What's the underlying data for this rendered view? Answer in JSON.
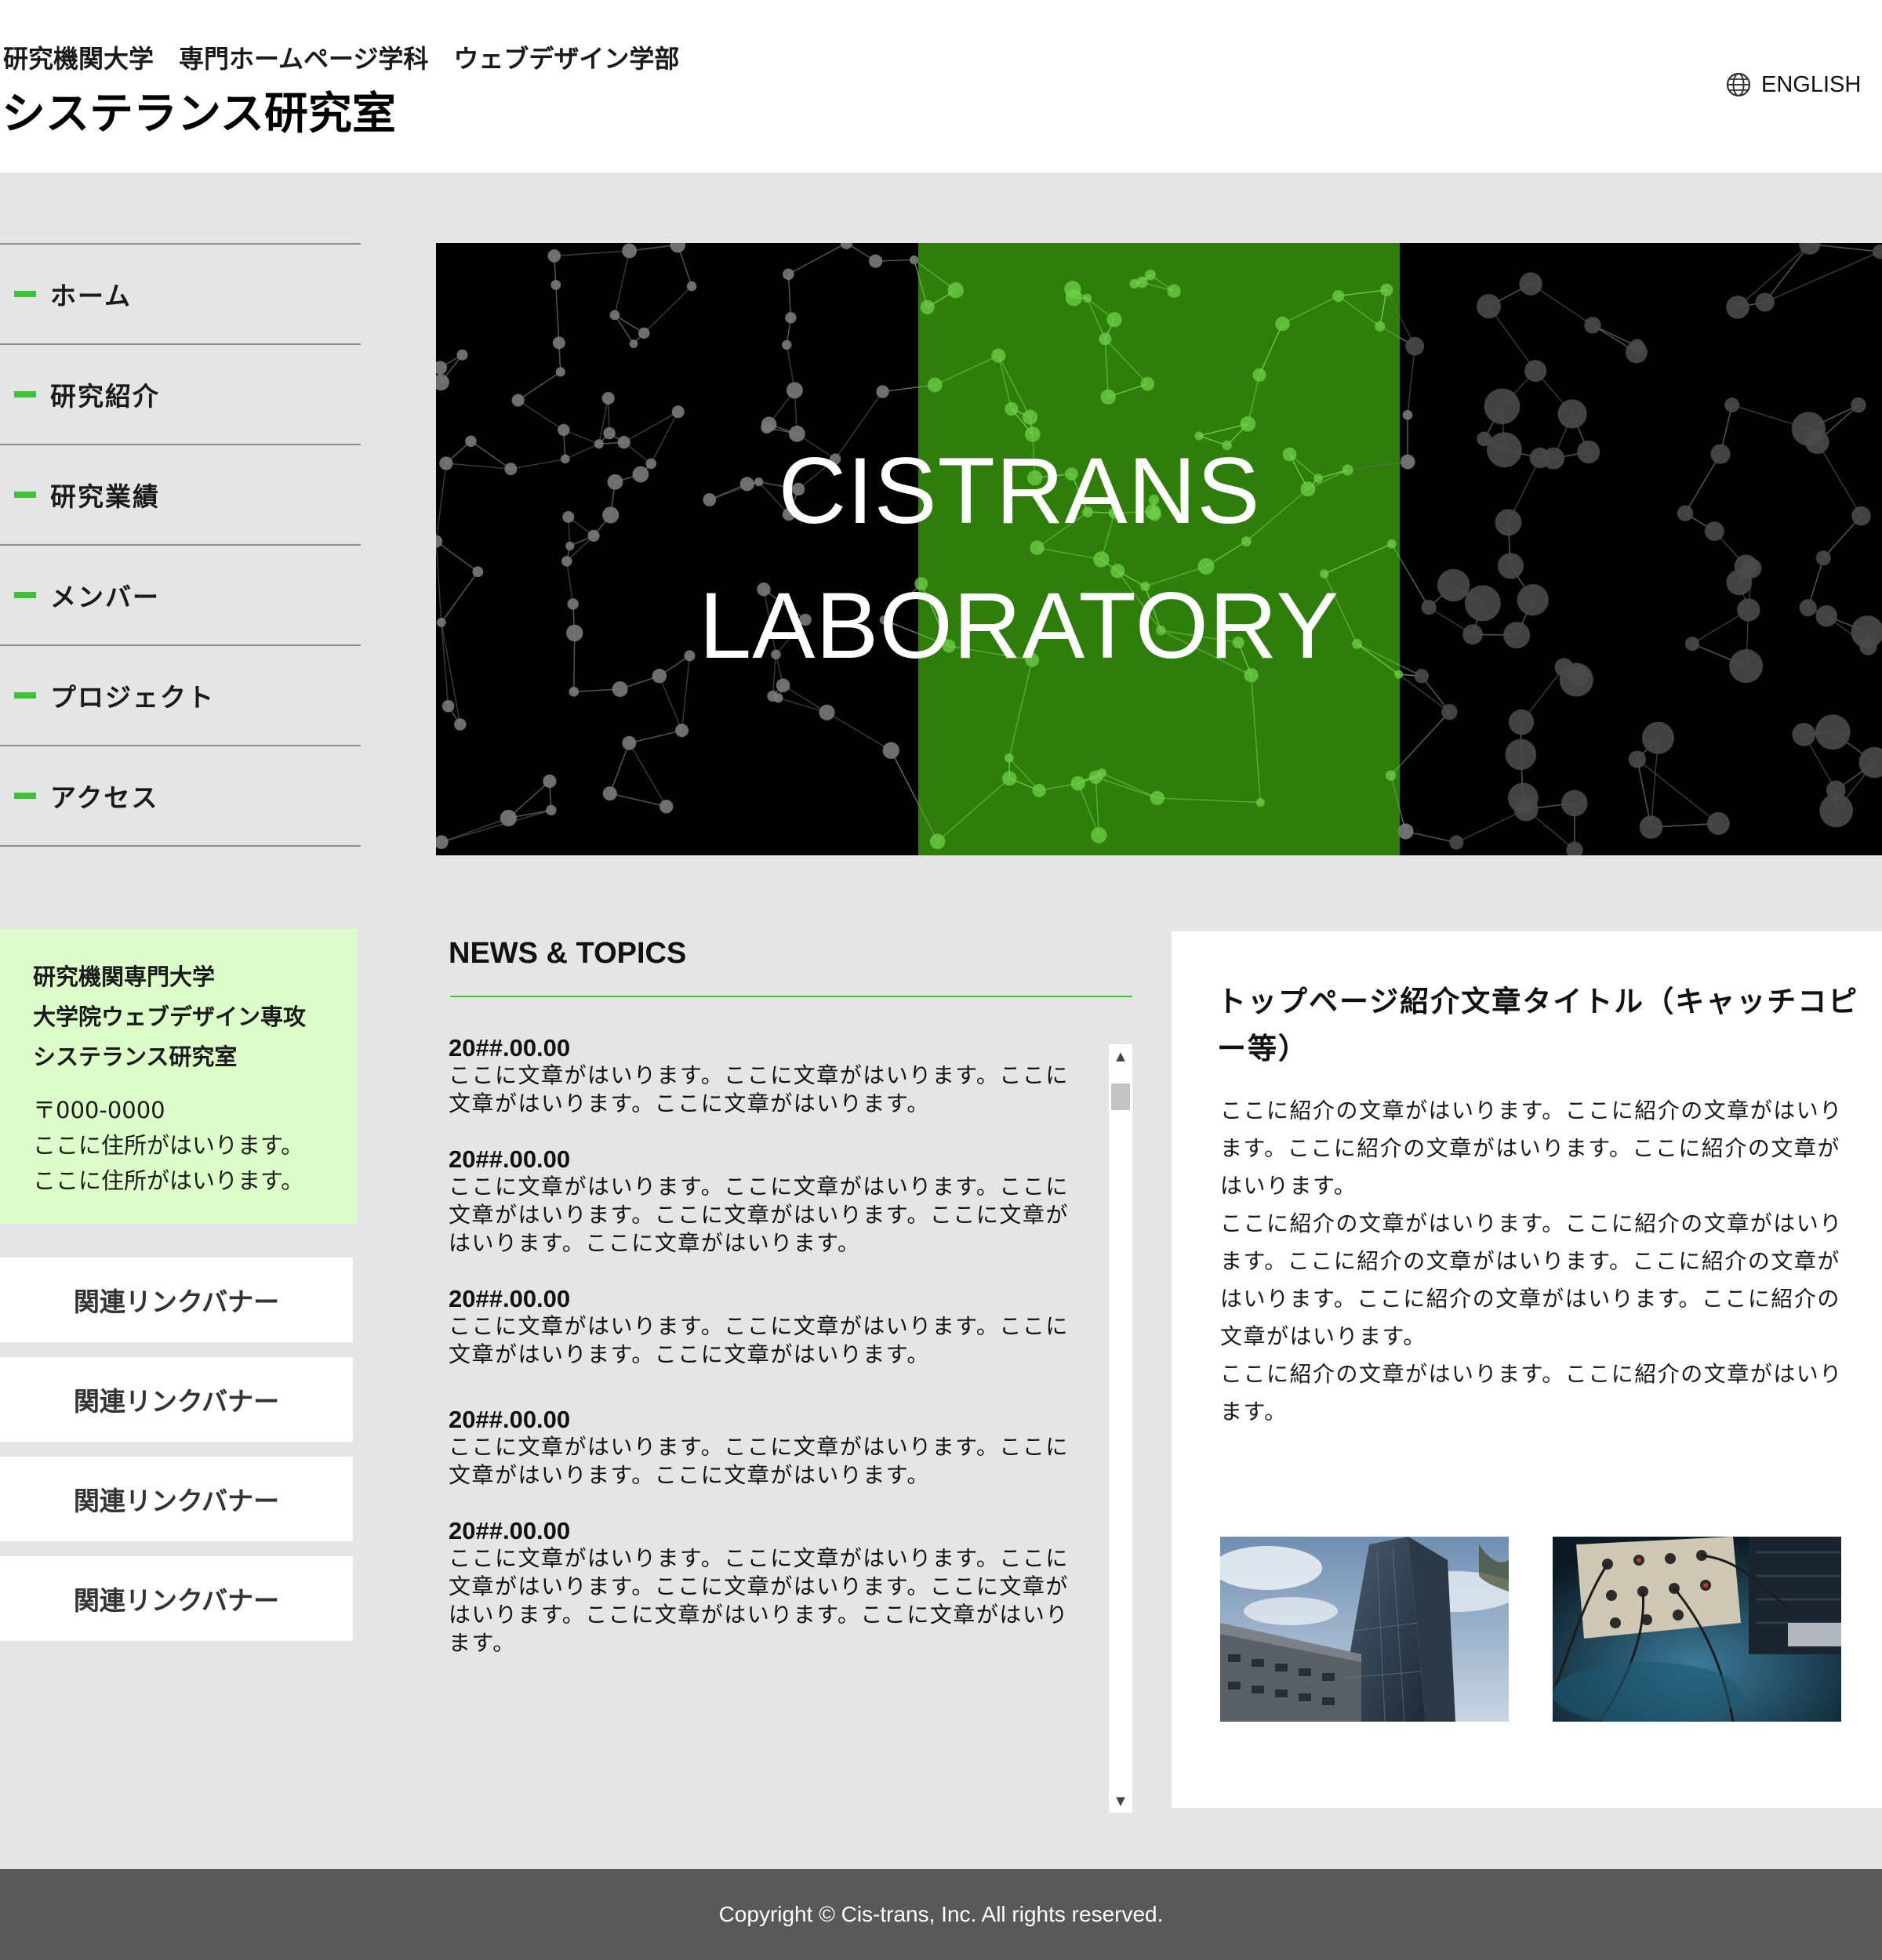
{
  "header": {
    "subtitle": "研究機関大学　専門ホームページ学科　ウェブデザイン学部",
    "site_title": "システランス研究室",
    "lang_label": "ENGLISH"
  },
  "nav": {
    "items": [
      {
        "label": "ホーム"
      },
      {
        "label": "研究紹介"
      },
      {
        "label": "研究業績"
      },
      {
        "label": "メンバー"
      },
      {
        "label": "プロジェクト"
      },
      {
        "label": "アクセス"
      }
    ]
  },
  "hero": {
    "line1": "CISTRANS",
    "line2": "LABORATORY",
    "accent_color": "#2f7d0a"
  },
  "address": {
    "org_lines": [
      "研究機関専門大学",
      "大学院ウェブデザイン専攻",
      "システランス研究室"
    ],
    "zip": "〒000-0000",
    "lines": [
      "ここに住所がはいります。",
      "ここに住所がはいります。"
    ]
  },
  "banners": [
    "関連リンクバナー",
    "関連リンクバナー",
    "関連リンクバナー",
    "関連リンクバナー"
  ],
  "news": {
    "title": "NEWS & TOPICS",
    "items": [
      {
        "date": "20##.00.00",
        "text": "ここに文章がはいります。ここに文章がはいります。ここに文章がはいります。ここに文章がはいります。"
      },
      {
        "date": "20##.00.00",
        "text": "ここに文章がはいります。ここに文章がはいります。ここに文章がはいります。ここに文章がはいります。ここに文章がはいります。ここに文章がはいります。"
      },
      {
        "date": "20##.00.00",
        "text": "ここに文章がはいります。ここに文章がはいります。ここに文章がはいります。ここに文章がはいります。"
      },
      {
        "date": "20##.00.00",
        "text": "ここに文章がはいります。ここに文章がはいります。ここに文章がはいります。ここに文章がはいります。"
      },
      {
        "date": "20##.00.00",
        "text": "ここに文章がはいります。ここに文章がはいります。ここに文章がはいります。ここに文章がはいります。ここに文章がはいります。ここに文章がはいります。ここに文章がはいります。"
      }
    ]
  },
  "intro": {
    "title": "トップページ紹介文章タイトル（キャッチコピー等）",
    "paragraphs": [
      "ここに紹介の文章がはいります。ここに紹介の文章がはいります。ここに紹介の文章がはいります。ここに紹介の文章がはいります。",
      "ここに紹介の文章がはいります。ここに紹介の文章がはいります。ここに紹介の文章がはいります。ここに紹介の文章がはいります。ここに紹介の文章がはいります。ここに紹介の文章がはいります。",
      "ここに紹介の文章がはいります。ここに紹介の文章がはいります。"
    ]
  },
  "footer": {
    "copyright": "Copyright © Cis-trans, Inc. All rights reserved."
  },
  "colors": {
    "accent_green": "#3fc13a",
    "address_bg": "#dcfcca",
    "footer_bg": "#595959"
  }
}
